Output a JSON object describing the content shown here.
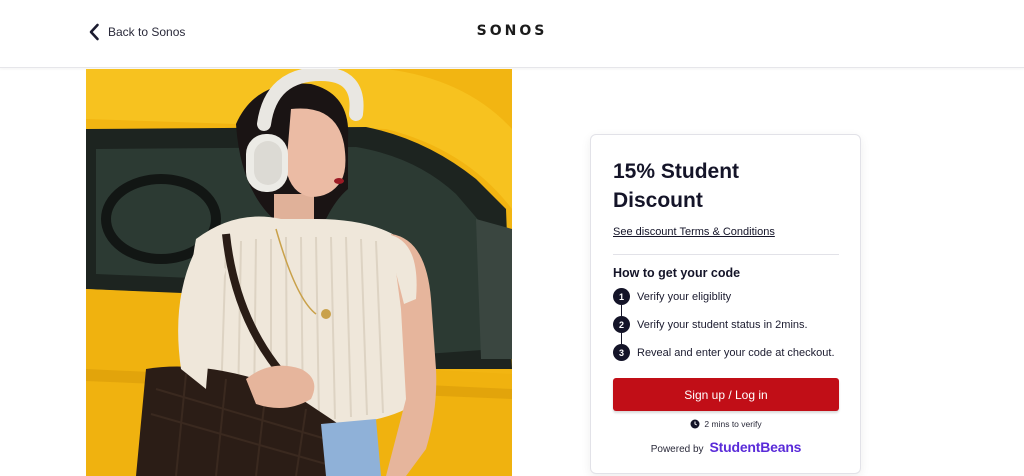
{
  "header": {
    "back_label": "Back to Sonos",
    "logo_text": "SONOS"
  },
  "hero": {
    "image": "student-with-headphones-taxi-photo"
  },
  "offer": {
    "title": "15% Student Discount",
    "terms_link": "See discount Terms & Conditions",
    "how_heading": "How to get your code",
    "steps": [
      {
        "num": "1",
        "text": "Verify your eligiblity"
      },
      {
        "num": "2",
        "text": "Verify your student status in 2mins."
      },
      {
        "num": "3",
        "text": "Reveal and enter your code at checkout."
      }
    ],
    "cta_label": "Sign up / Log in",
    "verify_note": "2 mins to verify",
    "powered_by": "Powered by",
    "partner_brand": "StudentBeans"
  },
  "colors": {
    "cta": "#c10e17",
    "brand_purple": "#5a2bd9",
    "navy": "#141428",
    "taxi_yellow": "#f0b514"
  }
}
